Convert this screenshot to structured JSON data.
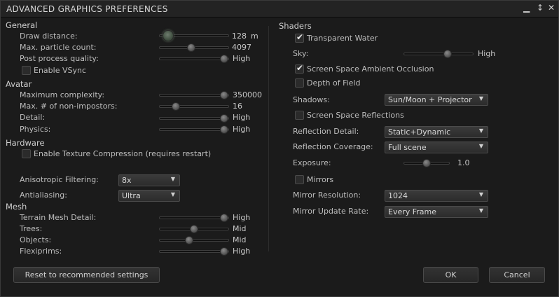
{
  "window": {
    "title": "ADVANCED GRAPHICS PREFERENCES",
    "min_glyph": "▁",
    "pin_glyph": "↕",
    "close_glyph": "✕"
  },
  "sections": {
    "general": "General",
    "avatar": "Avatar",
    "hardware": "Hardware",
    "mesh": "Mesh",
    "shaders": "Shaders"
  },
  "general": {
    "draw_distance": {
      "label": "Draw distance:",
      "value": "128",
      "unit": "m",
      "level": 0.05
    },
    "max_particle": {
      "label": "Max. particle count:",
      "value": "4097",
      "level": 0.45
    },
    "post_process": {
      "label": "Post process quality:",
      "value": "High",
      "level": 1.0
    },
    "vsync": {
      "label": "Enable VSync",
      "checked": false
    }
  },
  "avatar": {
    "max_complexity": {
      "label": "Maximum complexity:",
      "value": "350000",
      "level": 1.0
    },
    "non_impostors": {
      "label": "Max. # of non-impostors:",
      "value": "16",
      "level": 0.2
    },
    "detail": {
      "label": "Detail:",
      "value": "High",
      "level": 1.0
    },
    "physics": {
      "label": "Physics:",
      "value": "High",
      "level": 1.0
    }
  },
  "hardware": {
    "texture_compression": {
      "label": "Enable Texture Compression (requires restart)",
      "checked": false
    },
    "anisotropic": {
      "label": "Anisotropic Filtering:",
      "value": "8x"
    },
    "antialiasing": {
      "label": "Antialiasing:",
      "value": "Ultra"
    }
  },
  "mesh": {
    "terrain": {
      "label": "Terrain Mesh Detail:",
      "value": "High",
      "level": 1.0
    },
    "trees": {
      "label": "Trees:",
      "value": "Mid",
      "level": 0.5
    },
    "objects": {
      "label": "Objects:",
      "value": "Mid",
      "level": 0.42
    },
    "flexiprims": {
      "label": "Flexiprims:",
      "value": "High",
      "level": 1.0
    }
  },
  "shaders": {
    "transparent_water": {
      "label": "Transparent Water",
      "checked": true
    },
    "sky": {
      "label": "Sky:",
      "value": "High",
      "level": 0.65
    },
    "ssao": {
      "label": "Screen Space Ambient Occlusion",
      "checked": true
    },
    "dof": {
      "label": "Depth of Field",
      "checked": false
    },
    "shadows": {
      "label": "Shadows:",
      "value": "Sun/Moon + Projector"
    },
    "ssr": {
      "label": "Screen Space Reflections",
      "checked": false
    },
    "reflection_detail": {
      "label": "Reflection Detail:",
      "value": "Static+Dynamic"
    },
    "reflection_coverage": {
      "label": "Reflection Coverage:",
      "value": "Full scene"
    },
    "exposure": {
      "label": "Exposure:",
      "value": "1.0",
      "level": 0.5
    },
    "mirrors": {
      "label": "Mirrors",
      "checked": false
    },
    "mirror_resolution": {
      "label": "Mirror Resolution:",
      "value": "1024"
    },
    "mirror_update": {
      "label": "Mirror Update Rate:",
      "value": "Every Frame"
    }
  },
  "buttons": {
    "reset": "Reset to recommended settings",
    "ok": "OK",
    "cancel": "Cancel"
  },
  "glyphs": {
    "check": "✔",
    "dropdown": "▼"
  }
}
